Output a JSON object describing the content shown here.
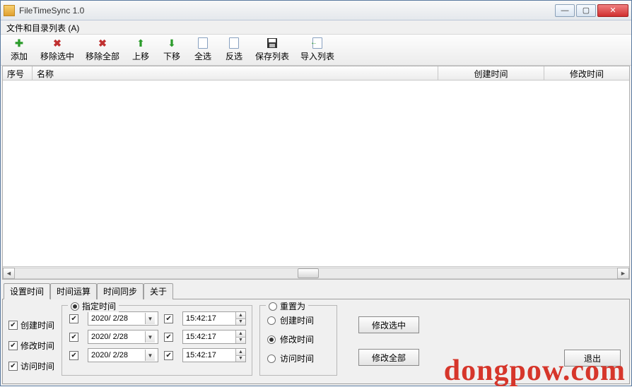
{
  "title": "FileTimeSync 1.0",
  "menu": {
    "files_list": "文件和目录列表 (A)"
  },
  "toolbar": {
    "add": "添加",
    "remove_selected": "移除选中",
    "remove_all": "移除全部",
    "move_up": "上移",
    "move_down": "下移",
    "select_all": "全选",
    "invert_select": "反选",
    "save_list": "保存列表",
    "import_list": "导入列表"
  },
  "columns": {
    "index": "序号",
    "name": "名称",
    "created": "创建时间",
    "modified": "修改时间"
  },
  "tabs": {
    "set_time": "设置时间",
    "time_calc": "时间运算",
    "time_sync": "时间同步",
    "about": "关于"
  },
  "left_checks": {
    "created": "创建时间",
    "modified": "修改时间",
    "accessed": "访问时间"
  },
  "fieldset_specify": "指定时间",
  "date_value": "2020/ 2/28",
  "time_value": "15:42:17",
  "fieldset_reset": "重置为",
  "reset_options": {
    "created": "创建时间",
    "modified": "修改时间",
    "accessed": "访问时间"
  },
  "buttons": {
    "modify_selected": "修改选中",
    "modify_all": "修改全部",
    "exit": "退出"
  },
  "watermark": "dongpow.com"
}
